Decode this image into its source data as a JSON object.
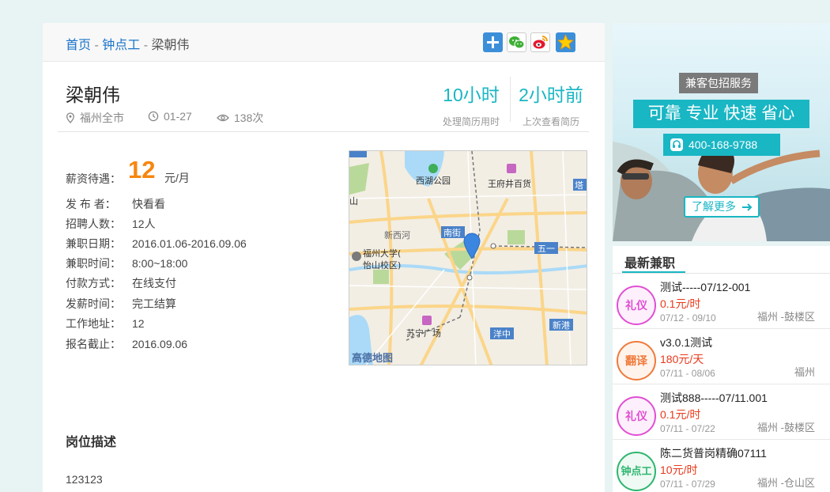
{
  "breadcrumb": {
    "home": "首页",
    "sep1": " - ",
    "category": "钟点工",
    "sep2": " - ",
    "current": "梁朝伟"
  },
  "share_icons": [
    "plus-share-icon",
    "wechat-icon",
    "weibo-icon",
    "qzone-star-icon"
  ],
  "job": {
    "title": "梁朝伟",
    "location": "福州全市",
    "date": "01-27",
    "views": "138次",
    "stats": [
      {
        "value": "10小时",
        "label": "处理简历用时"
      },
      {
        "value": "2小时前",
        "label": "上次查看简历"
      }
    ],
    "salary": {
      "label": "薪资待遇：",
      "amount": "12",
      "unit": "元/月"
    },
    "details": [
      {
        "key": "发 布 者：",
        "value": "快看看"
      },
      {
        "key": "招聘人数：",
        "value": "12人"
      },
      {
        "key": "兼职日期：",
        "value": "2016.01.06-2016.09.06"
      },
      {
        "key": "兼职时间：",
        "value": "8:00~18:00"
      },
      {
        "key": "付款方式：",
        "value": "在线支付"
      },
      {
        "key": "发薪时间：",
        "value": "完工结算"
      },
      {
        "key": "工作地址：",
        "value": "12"
      },
      {
        "key": "报名截止：",
        "value": "2016.09.06"
      }
    ],
    "description_heading": "岗位描述",
    "description": "123123"
  },
  "map": {
    "labels": [
      "西湖公园",
      "王府井百货",
      "塔",
      "山",
      "南街",
      "新西河",
      "福州大学(",
      "怡山校区)",
      "五一",
      "苏宁广场",
      "洋中",
      "新港",
      "高德地图"
    ]
  },
  "banner": {
    "tag": "兼客包招服务",
    "slogan": "可靠 专业 快速 省心",
    "phone": "400-168-9788",
    "more": "了解更多"
  },
  "latest": {
    "heading": "最新兼职",
    "items": [
      {
        "badge": "礼仪",
        "badge_color": "#e14fd4",
        "title": "测试-----07/12-001",
        "pay": "0.1元/时",
        "dates": "07/12 - 09/10",
        "location": "福州 -鼓楼区"
      },
      {
        "badge": "翻译",
        "badge_color": "#f07a3a",
        "title": "v3.0.1测试",
        "pay": "180元/天",
        "dates": "07/11 - 08/06",
        "location": "福州"
      },
      {
        "badge": "礼仪",
        "badge_color": "#e14fd4",
        "title": "测试888-----07/11.001",
        "pay": "0.1元/时",
        "dates": "07/11 - 07/22",
        "location": "福州 -鼓楼区"
      },
      {
        "badge": "钟点工",
        "badge_color": "#2db66e",
        "title": "陈二货普岗精确07111",
        "pay": "10元/时",
        "dates": "07/11 - 07/29",
        "location": "福州 -仓山区"
      }
    ]
  }
}
